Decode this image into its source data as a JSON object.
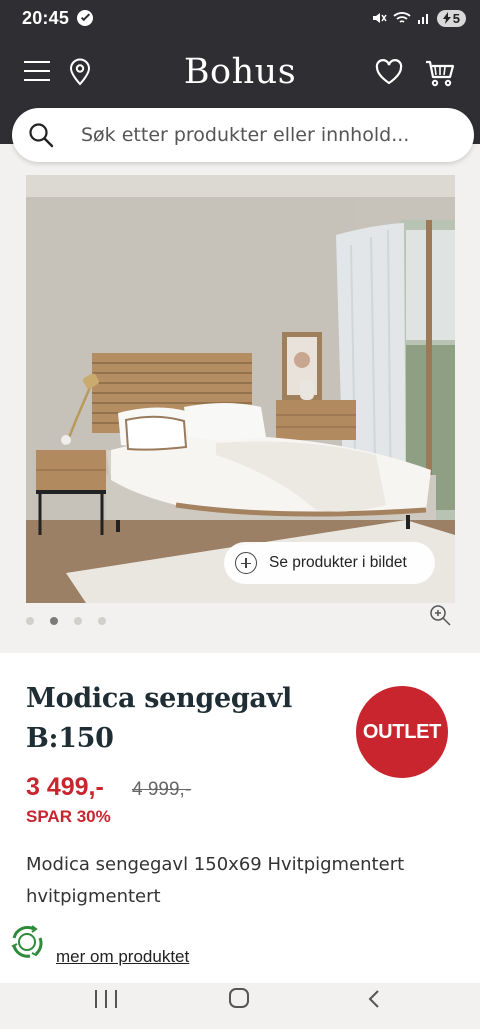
{
  "status_bar": {
    "time": "20:45",
    "battery": "5"
  },
  "header": {
    "logo": "Bohus",
    "icons": [
      "menu-icon",
      "location-pin-icon",
      "heart-icon",
      "cart-icon"
    ]
  },
  "search": {
    "placeholder": "Søk etter produkter eller innhold..."
  },
  "gallery": {
    "see_products_label": "Se produkter i bildet",
    "slide_count": 4,
    "active_slide": 2
  },
  "product": {
    "title_line1": "Modica sengegavl",
    "title_line2": "B:150",
    "badge": "OUTLET",
    "price": "3 499,-",
    "old_price": "4 999,-",
    "save": "SPAR 30%",
    "description": "Modica sengegavl 150x69 Hvitpigmentert hvitpigmentert",
    "more_link": "mer om produktet"
  },
  "colors": {
    "header_bg": "#2f2f33",
    "accent_red": "#c8252f",
    "title_color": "#1f2d34"
  }
}
